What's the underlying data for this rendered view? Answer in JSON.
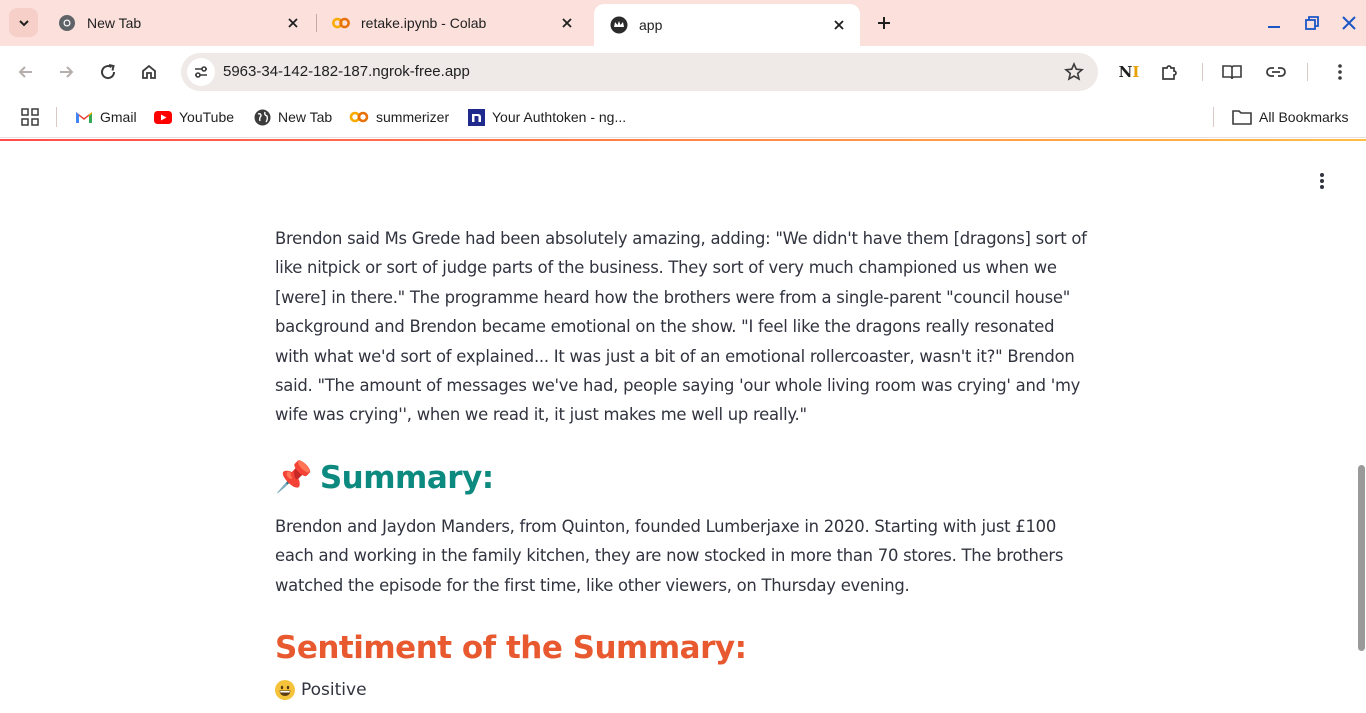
{
  "browser": {
    "tabs": [
      {
        "title": "New Tab",
        "icon": "chrome-icon",
        "active": false
      },
      {
        "title": "retake.ipynb - Colab",
        "icon": "colab-icon",
        "active": false
      },
      {
        "title": "app",
        "icon": "streamlit-crown-icon",
        "active": true
      }
    ],
    "url": "5963-34-142-182-187.ngrok-free.app",
    "bookmarks": [
      {
        "label": "Gmail",
        "icon": "gmail-icon"
      },
      {
        "label": "YouTube",
        "icon": "youtube-icon"
      },
      {
        "label": "New Tab",
        "icon": "globe-icon"
      },
      {
        "label": "summerizer",
        "icon": "colab-icon"
      },
      {
        "label": "Your Authtoken - ng...",
        "icon": "ngrok-icon"
      }
    ],
    "all_bookmarks_label": "All Bookmarks",
    "colors": {
      "tabstrip": "#fbe0dc",
      "accent_line_start": "#ff4b4b",
      "accent_line_end": "#ffbd45"
    }
  },
  "app": {
    "article_text": "Brendon said Ms Grede had been absolutely amazing, adding: \"We didn't have them [dragons] sort of like nitpick or sort of judge parts of the business. They sort of very much championed us when we [were] in there.\" The programme heard how the brothers were from a single-parent \"council house\" background and Brendon became emotional on the show. \"I feel like the dragons really resonated with what we'd sort of explained... It was just a bit of an emotional rollercoaster, wasn't it?\" Brendon said. \"The amount of messages we've had, people saying 'our whole living room was crying' and 'my wife was crying'', when we read it, it just makes me well up really.\"",
    "summary_heading": "Summary:",
    "summary_icon": "📌",
    "summary_text": "Brendon and Jaydon Manders, from Quinton, founded Lumberjaxe in 2020. Starting with just £100 each and working in the family kitchen, they are now stocked in more than 70 stores. The brothers watched the episode for the first time, like other viewers, on Thursday evening.",
    "sentiment_heading": "Sentiment of the Summary:",
    "sentiment_value": "Positive",
    "sentiment_icon": "grinning-face-icon",
    "colors": {
      "summary_heading": "#0d8a80",
      "sentiment_heading": "#e8592f",
      "text": "#31333f"
    }
  }
}
